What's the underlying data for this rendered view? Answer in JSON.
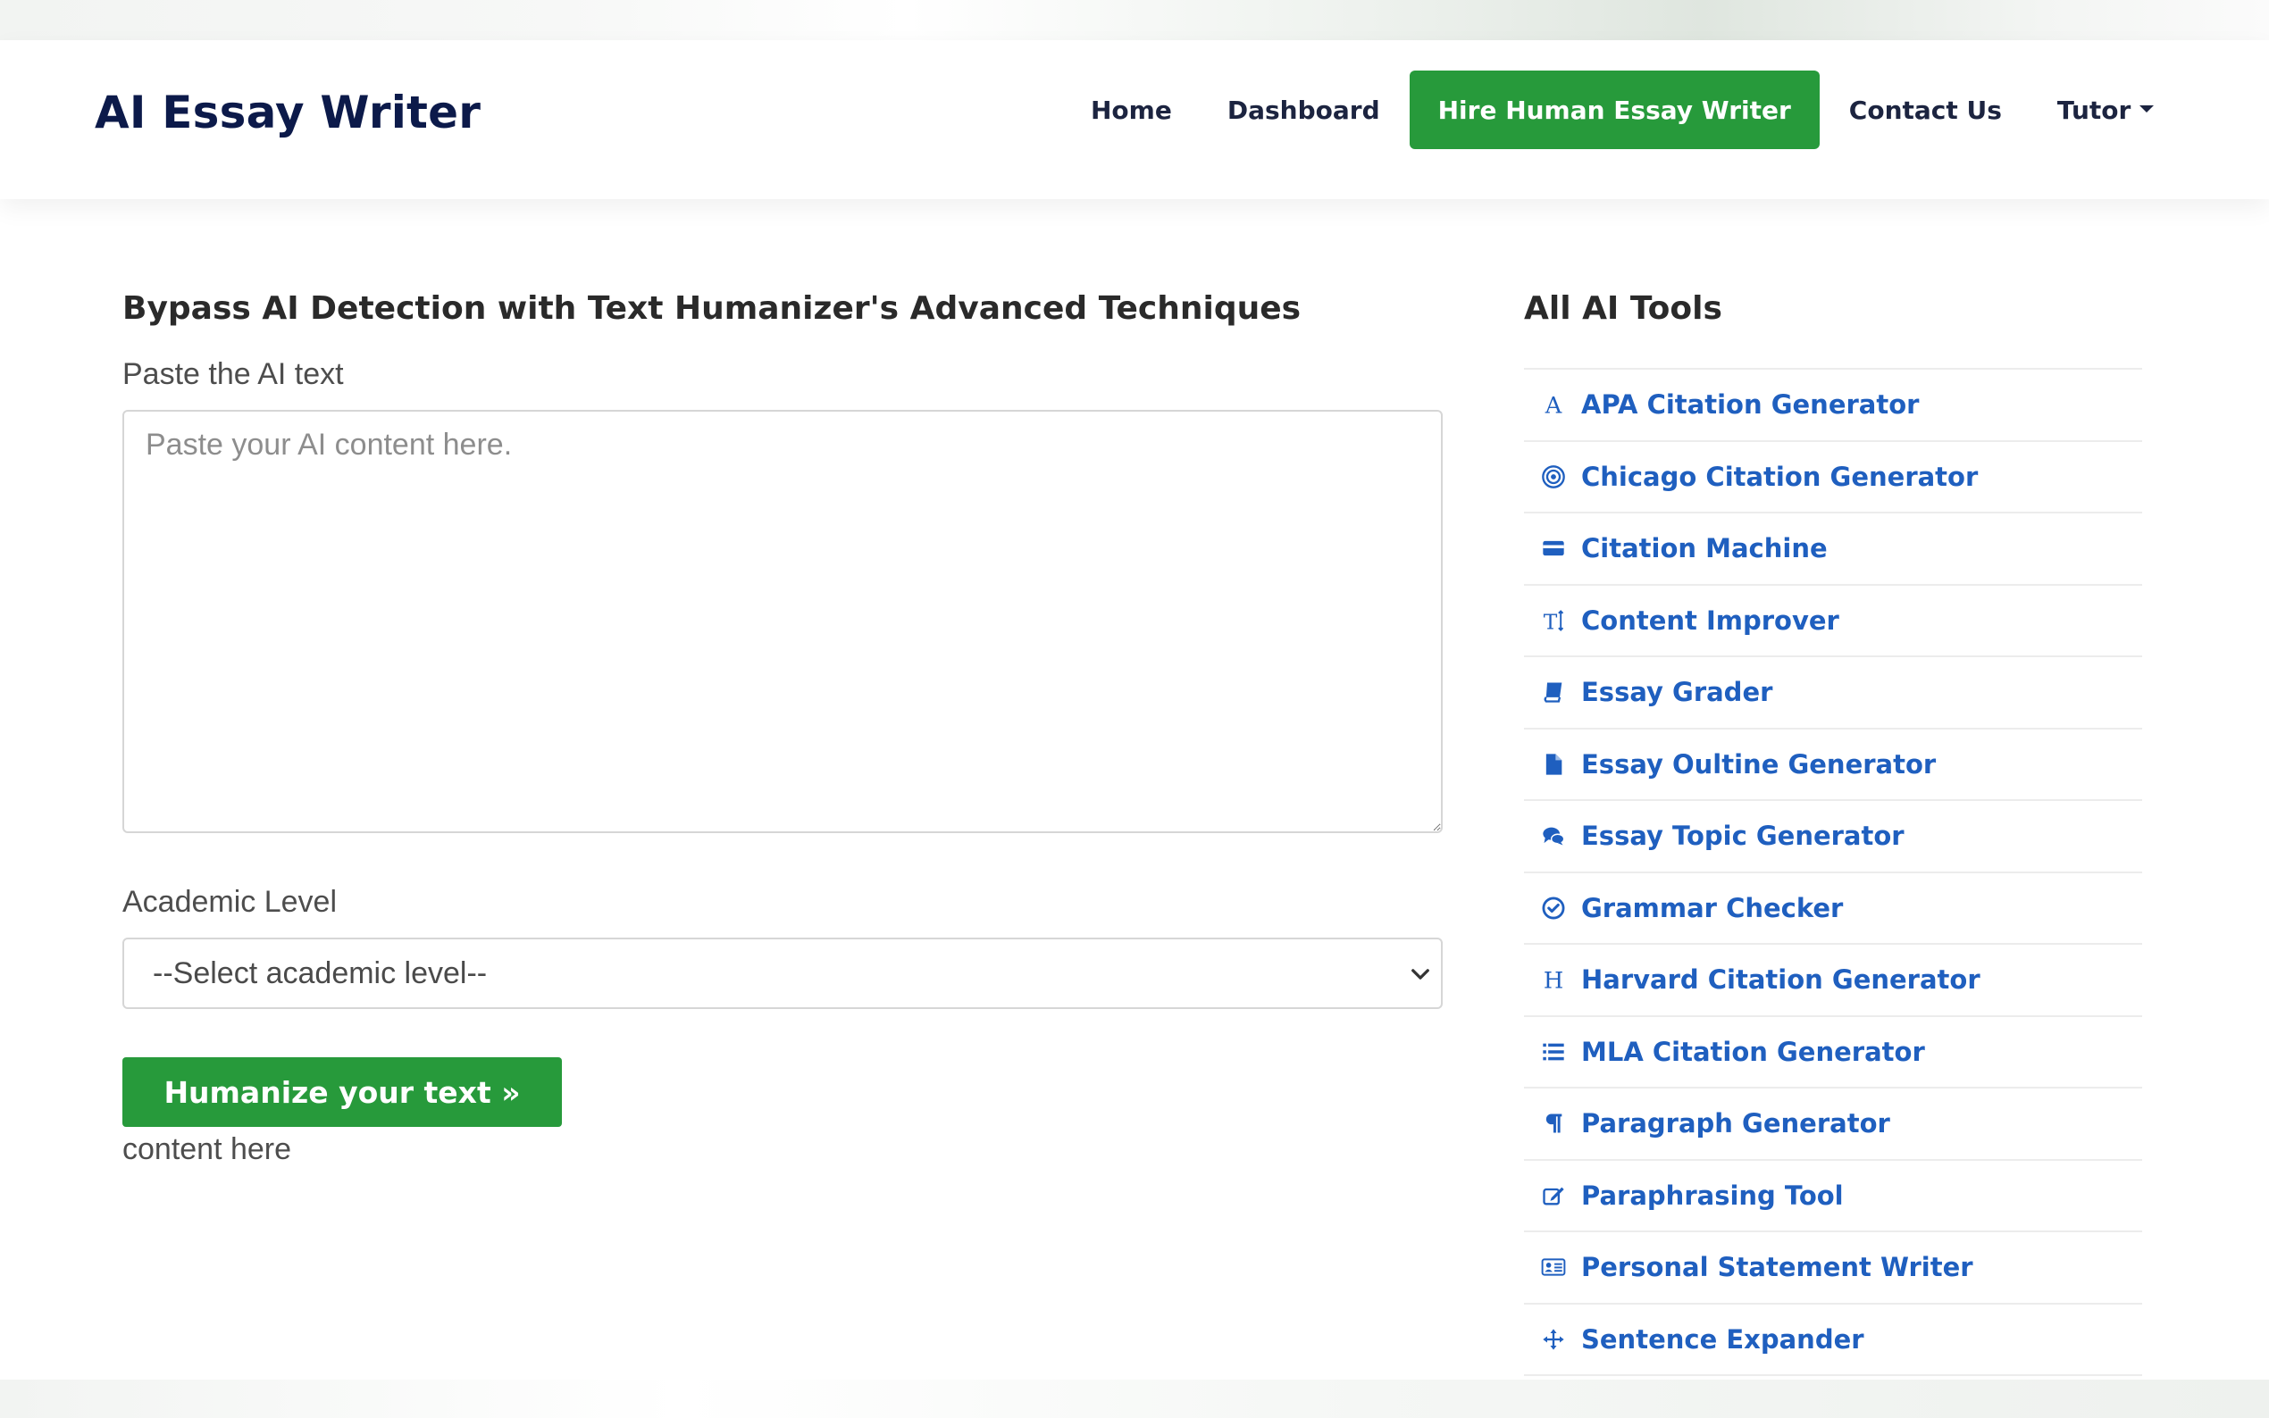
{
  "header": {
    "brand": "AI Essay Writer",
    "nav": [
      {
        "label": "Home"
      },
      {
        "label": "Dashboard"
      },
      {
        "label": "Hire Human Essay Writer"
      },
      {
        "label": "Contact Us"
      },
      {
        "label": "Tutor"
      }
    ]
  },
  "main": {
    "title": "Bypass AI Detection with Text Humanizer's Advanced Techniques",
    "paste_label": "Paste the AI text",
    "textarea_placeholder": "Paste your AI content here.",
    "textarea_value": "",
    "level_label": "Academic Level",
    "level_selected": "--Select academic level--",
    "submit_label": "Humanize your text »",
    "after_text": "content here"
  },
  "sidebar": {
    "title": "All AI Tools",
    "tools": [
      {
        "label": "APA Citation Generator",
        "icon": "font-a-icon"
      },
      {
        "label": "Chicago Citation Generator",
        "icon": "bullseye-icon"
      },
      {
        "label": "Citation Machine",
        "icon": "credit-card-icon"
      },
      {
        "label": "Content Improver",
        "icon": "text-height-icon"
      },
      {
        "label": "Essay Grader",
        "icon": "book-icon"
      },
      {
        "label": "Essay Oultine Generator",
        "icon": "file-icon"
      },
      {
        "label": "Essay Topic Generator",
        "icon": "comments-icon"
      },
      {
        "label": "Grammar Checker",
        "icon": "check-circle-icon"
      },
      {
        "label": "Harvard Citation Generator",
        "icon": "header-h-icon"
      },
      {
        "label": "MLA Citation Generator",
        "icon": "list-icon"
      },
      {
        "label": "Paragraph Generator",
        "icon": "paragraph-icon"
      },
      {
        "label": "Paraphrasing Tool",
        "icon": "edit-icon"
      },
      {
        "label": "Personal Statement Writer",
        "icon": "id-card-icon"
      },
      {
        "label": "Sentence Expander",
        "icon": "arrows-move-icon"
      }
    ]
  },
  "colors": {
    "accent_green": "#279a3b",
    "link_blue": "#1f5fbf",
    "brand_navy": "#0c1a4a"
  }
}
